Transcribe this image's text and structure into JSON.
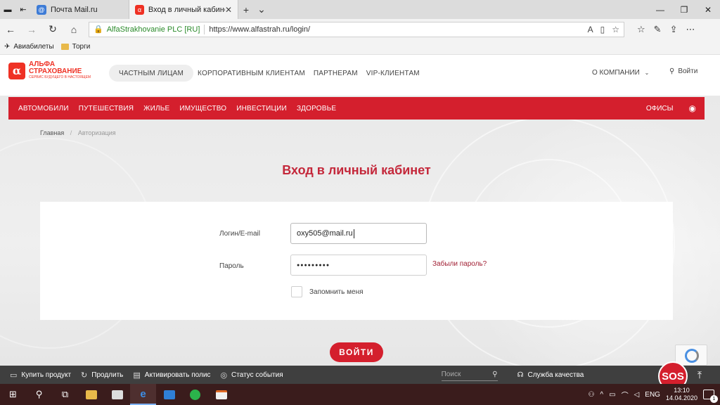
{
  "browser": {
    "tabs": [
      {
        "title": "Почта Mail.ru",
        "active": false
      },
      {
        "title": "Вход в личный кабинет",
        "active": true
      }
    ],
    "address": {
      "cert": "AlfaStrakhovanie PLC [RU]",
      "url": "https://www.alfastrah.ru/login/"
    },
    "favorites": [
      {
        "label": "Авиабилеты",
        "icon": "plane-icon"
      },
      {
        "label": "Торги",
        "icon": "folder-icon"
      }
    ]
  },
  "site": {
    "logo": {
      "line1": "АЛЬФА",
      "line2": "СТРАХОВАНИЕ",
      "slogan": "СЕРВИС БУДУЩЕГО В НАСТОЯЩЕМ"
    },
    "topnav": [
      {
        "label": "ЧАСТНЫМ ЛИЦАМ",
        "selected": true
      },
      {
        "label": "КОРПОРАТИВНЫМ КЛИЕНТАМ",
        "selected": false
      },
      {
        "label": "ПАРТНЕРАМ",
        "selected": false
      },
      {
        "label": "VIP-КЛИЕНТАМ",
        "selected": false
      }
    ],
    "about": "О КОМПАНИИ",
    "login": "Войти",
    "categories": [
      "АВТОМОБИЛИ",
      "ПУТЕШЕСТВИЯ",
      "ЖИЛЬЕ",
      "ИМУЩЕСТВО",
      "ИНВЕСТИЦИИ",
      "ЗДОРОВЬЕ"
    ],
    "offices": "ОФИСЫ",
    "breadcrumb": {
      "home": "Главная",
      "current": "Авторизация"
    },
    "page_title": "Вход в личный кабинет",
    "form": {
      "login_label": "Логин/E-mail",
      "login_value": "oxy505@mail.ru",
      "password_label": "Пароль",
      "password_value": "●●●●●●●●●",
      "forgot": "Забыли пароль?",
      "remember": "Запомнить меня",
      "submit": "ВОЙТИ"
    },
    "bottombar": {
      "buy": "Купить продукт",
      "extend": "Продлить",
      "activate": "Активировать полис",
      "status": "Статус события",
      "search_placeholder": "Поиск",
      "quality": "Служба качества",
      "sos": "SOS"
    }
  },
  "taskbar": {
    "lang": "ENG",
    "time": "13:10",
    "date": "14.04.2020",
    "notifications": "1"
  },
  "colors": {
    "brand_red": "#d41f2d",
    "title_red": "#c4283b"
  }
}
